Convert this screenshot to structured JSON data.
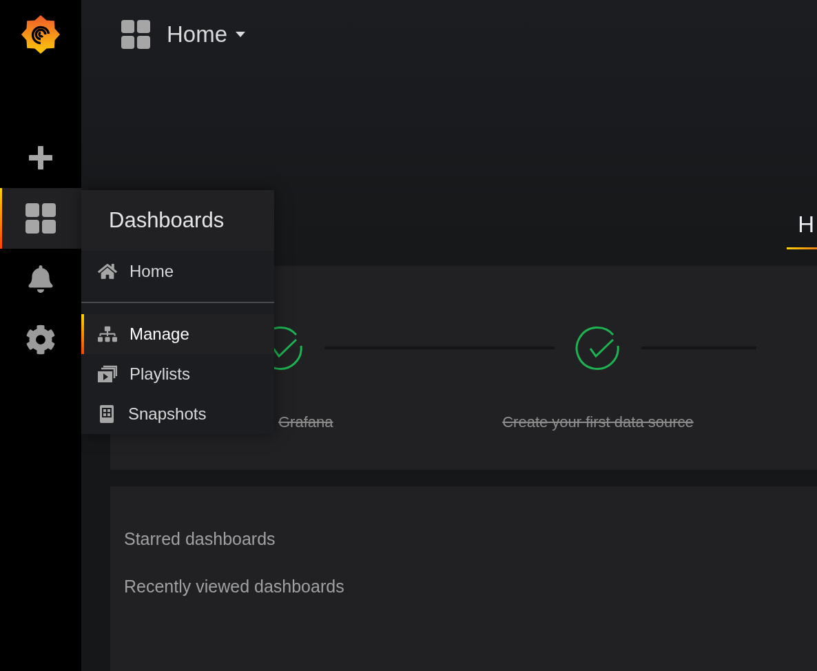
{
  "sidebar": {
    "items": [
      {
        "kind": "create",
        "selected": false
      },
      {
        "kind": "dashboards",
        "selected": true
      },
      {
        "kind": "alerting",
        "selected": false
      },
      {
        "kind": "configuration",
        "selected": false
      }
    ]
  },
  "header": {
    "title": "Home"
  },
  "menu": {
    "title": "Dashboards",
    "sections": [
      [
        {
          "kind": "home",
          "label": "Home",
          "selected": false
        }
      ],
      [
        {
          "kind": "manage",
          "label": "Manage",
          "selected": true
        },
        {
          "kind": "playlists",
          "label": "Playlists",
          "selected": false
        },
        {
          "kind": "snapshots",
          "label": "Snapshots",
          "selected": false
        }
      ]
    ]
  },
  "tabs": [
    {
      "label": "H",
      "selected": true
    }
  ],
  "steps": [
    {
      "label": "Grafana",
      "done": true
    },
    {
      "label": "Create your first data source",
      "done": true
    }
  ],
  "dashboards_panel": {
    "sections": [
      "Starred dashboards",
      "Recently viewed dashboards"
    ]
  }
}
